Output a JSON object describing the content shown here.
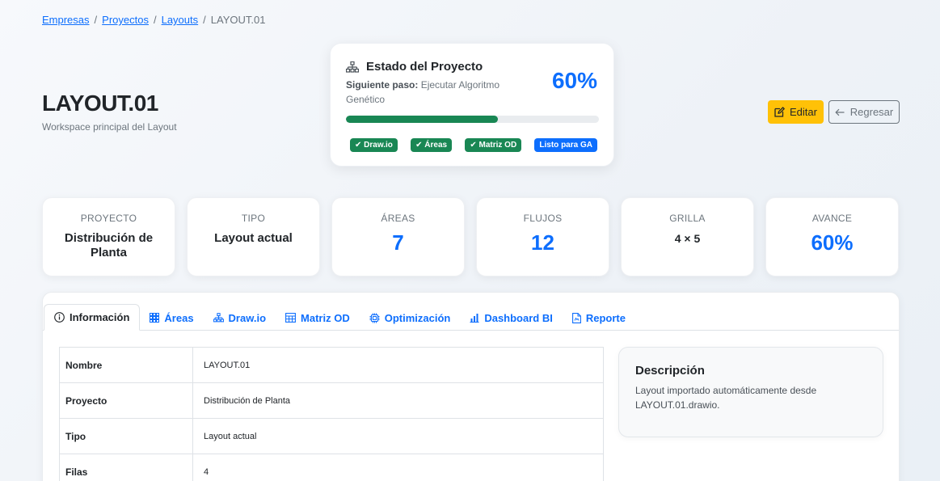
{
  "breadcrumb": {
    "items": [
      "Empresas",
      "Proyectos",
      "Layouts"
    ],
    "separator": "/",
    "current": "LAYOUT.01"
  },
  "header": {
    "title": "LAYOUT.01",
    "subtitle": "Workspace principal del Layout"
  },
  "status": {
    "title": "Estado del Proyecto",
    "next_label": "Siguiente paso:",
    "next_value": "Ejecutar Algoritmo Genético",
    "percent_text": "60%",
    "progress": 0.6,
    "badges": [
      {
        "label": "✔ Draw.io",
        "color": "#198754"
      },
      {
        "label": "✔ Áreas",
        "color": "#198754"
      },
      {
        "label": "✔ Matriz OD",
        "color": "#198754"
      },
      {
        "label": "Listo para GA",
        "color": "#0d6efd"
      }
    ]
  },
  "actions": {
    "edit_label": "Editar",
    "back_label": "Regresar"
  },
  "stats": [
    {
      "label": "PROYECTO",
      "value": "Distribución de Planta"
    },
    {
      "label": "TIPO",
      "value": "Layout actual"
    },
    {
      "label": "ÁREAS",
      "value": "7"
    },
    {
      "label": "FLUJOS",
      "value": "12"
    },
    {
      "label": "GRILLA",
      "value": "4 × 5"
    },
    {
      "label": "AVANCE",
      "value": "60%"
    }
  ],
  "tabs": [
    {
      "label": "Información",
      "icon": "info-icon",
      "active": true
    },
    {
      "label": "Áreas",
      "icon": "grid-icon"
    },
    {
      "label": "Draw.io",
      "icon": "diagram-icon"
    },
    {
      "label": "Matriz OD",
      "icon": "table-icon"
    },
    {
      "label": "Optimización",
      "icon": "cpu-icon"
    },
    {
      "label": "Dashboard BI",
      "icon": "bar-chart-icon"
    },
    {
      "label": "Reporte",
      "icon": "file-icon"
    }
  ],
  "info_table": [
    {
      "key": "Nombre",
      "value": "LAYOUT.01"
    },
    {
      "key": "Proyecto",
      "value": "Distribución de Planta"
    },
    {
      "key": "Tipo",
      "value": "Layout actual"
    },
    {
      "key": "Filas",
      "value": "4"
    }
  ],
  "description": {
    "title": "Descripción",
    "text": "Layout importado automáticamente desde LAYOUT.01.drawio."
  },
  "colors": {
    "accent": "#0d6efd",
    "success": "#198754",
    "warning": "#ffc107"
  }
}
